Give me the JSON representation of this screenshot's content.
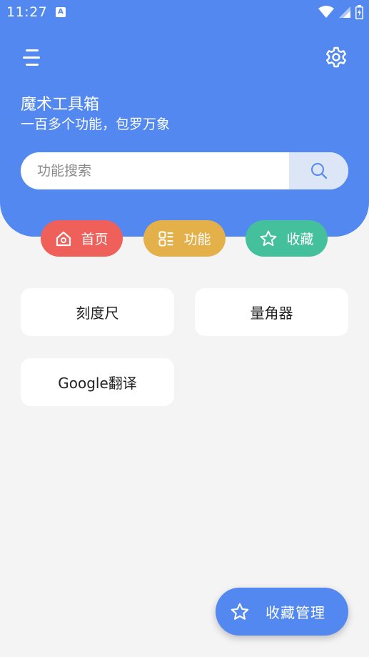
{
  "status_bar": {
    "time": "11:27",
    "notification_letter": "A",
    "icons": [
      "wifi-icon",
      "signal-icon",
      "battery-icon"
    ]
  },
  "header": {
    "title": "魔术工具箱",
    "subtitle": "一百多个功能，包罗万象",
    "menu_icon": "menu-icon",
    "settings_icon": "gear-icon"
  },
  "search": {
    "placeholder": "功能搜索",
    "value": "",
    "button_icon": "search-icon"
  },
  "tabs": [
    {
      "label": "首页",
      "icon": "home-icon",
      "color": "#f0605a"
    },
    {
      "label": "功能",
      "icon": "apps-icon",
      "color": "#e3b04a"
    },
    {
      "label": "收藏",
      "icon": "star-icon",
      "color": "#45c09c"
    }
  ],
  "tools": [
    {
      "label": "刻度尺"
    },
    {
      "label": "量角器"
    },
    {
      "label": "Google翻译"
    }
  ],
  "fab": {
    "label": "收藏管理",
    "icon": "star-icon"
  },
  "colors": {
    "primary": "#5288ef",
    "background": "#f4f4f4",
    "card": "#ffffff"
  }
}
